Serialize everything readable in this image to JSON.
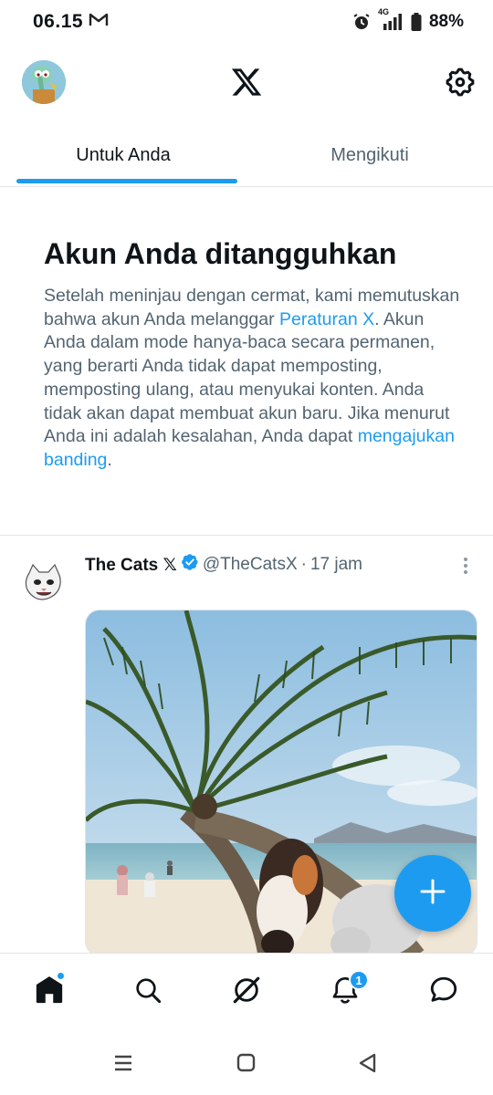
{
  "status_bar": {
    "time": "06.15",
    "network": "4G",
    "battery": "88%"
  },
  "tabs": [
    {
      "label": "Untuk Anda",
      "active": true
    },
    {
      "label": "Mengikuti",
      "active": false
    }
  ],
  "notice": {
    "title": "Akun Anda ditangguhkan",
    "body_1": "Setelah meninjau dengan cermat, kami memutuskan bahwa akun Anda melanggar ",
    "link_1": "Peraturan X",
    "body_2": ". Akun Anda dalam mode hanya-baca secara permanen, yang berarti Anda tidak dapat memposting, memposting ulang, atau menyukai konten. Anda tidak akan dapat membuat akun baru. Jika menurut Anda ini adalah kesalahan, Anda dapat ",
    "link_2": "mengajukan banding",
    "body_3": "."
  },
  "tweet": {
    "name": "The Cats",
    "name_suffix": "𝕏",
    "handle": "@TheCatsX",
    "separator": "·",
    "time": "17 jam"
  },
  "bottom_nav": {
    "notifications_badge": "1"
  },
  "colors": {
    "accent": "#1d9bf0",
    "text_primary": "#0f1419",
    "text_secondary": "#536471",
    "divider": "#e1e5e8"
  },
  "icons": [
    "gmail-icon",
    "alarm-icon",
    "signal-icon",
    "battery-icon",
    "x-logo-icon",
    "settings-gear-icon",
    "more-vertical-icon",
    "verified-badge-icon",
    "plus-icon",
    "home-icon",
    "search-icon",
    "grok-icon",
    "bell-icon",
    "messages-icon",
    "recents-icon",
    "home-square-icon",
    "back-icon"
  ]
}
